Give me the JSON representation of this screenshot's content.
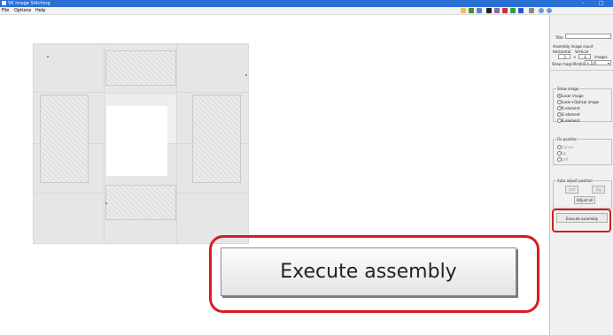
{
  "window": {
    "title": "VK Image Stitching",
    "minimize": "–",
    "close": "□"
  },
  "menu": {
    "file": "File",
    "options": "Options",
    "help": "Help"
  },
  "panel": {
    "title_label": "Title",
    "title_value": "",
    "assembly_count_label": "Assembly image count",
    "horizontal_label": "Horizontal",
    "vertical_label": "Vertical",
    "horizontal_value": "3",
    "times": "×",
    "vertical_value": "4",
    "images_label": "images",
    "show_magnification_label": "Show magnification",
    "show_magnification_value": "× 1/4",
    "show_image": {
      "caption": "Show image",
      "options": [
        "Laser image",
        "Laser+Optical image",
        "R element",
        "G element",
        "B element"
      ],
      "selected": 0
    },
    "fix_position": {
      "caption": "Fix position",
      "options": [
        "Cancel",
        "Up",
        "Left"
      ]
    },
    "auto_adjust": {
      "caption": "Auto adjust position",
      "left_label": "Left",
      "top_label": "Top",
      "adjust_all_label": "Adjust all"
    },
    "execute_label": "Execute assembly"
  },
  "callout": {
    "label": "Execute assembly"
  },
  "colors": {
    "highlight": "#d81c24",
    "titlebar": "#2a6fd6"
  }
}
